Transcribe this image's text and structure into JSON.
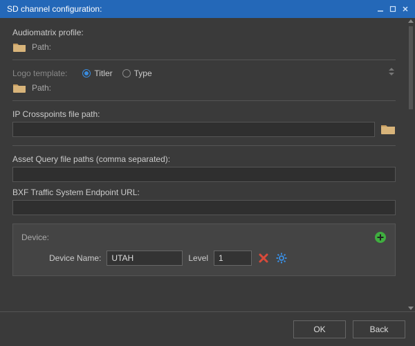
{
  "window": {
    "title": "SD channel configuration:"
  },
  "audiomatrix": {
    "label": "Audiomatrix profile:",
    "path_label": "Path:"
  },
  "logo": {
    "label": "Logo template:",
    "option_titler": "Titler",
    "option_type": "Type",
    "selected": "Titler",
    "path_label": "Path:"
  },
  "ip_crosspoints": {
    "label": "IP Crosspoints file path:",
    "value": ""
  },
  "asset_query": {
    "label": "Asset Query file paths (comma separated):",
    "value": ""
  },
  "bxf": {
    "label": "BXF Traffic System Endpoint URL:",
    "value": ""
  },
  "device": {
    "panel_label": "Device:",
    "name_label": "Device Name:",
    "name_value": "UTAH",
    "level_label": "Level",
    "level_value": "1"
  },
  "footer": {
    "ok": "OK",
    "back": "Back"
  }
}
